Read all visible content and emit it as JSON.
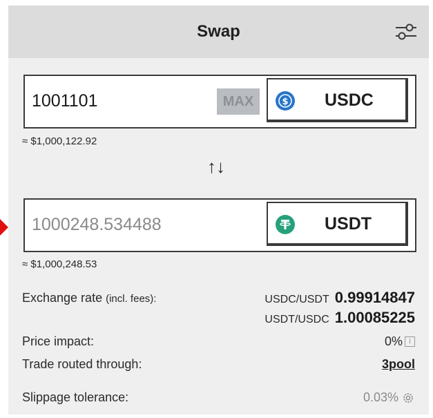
{
  "header": {
    "title": "Swap"
  },
  "from": {
    "amount": "1001101",
    "max_label": "MAX",
    "token": "USDC",
    "usd_estimate": "≈ $1,000,122.92"
  },
  "to": {
    "amount": "1000248.534488",
    "token": "USDT",
    "usd_estimate": "≈ $1,000,248.53"
  },
  "swap_icon": "↑↓",
  "details": {
    "exchange_rate_label": "Exchange rate",
    "exchange_rate_sublabel": "(incl. fees):",
    "rates": [
      {
        "pair": "USDC/USDT",
        "value": "0.99914847"
      },
      {
        "pair": "USDT/USDC",
        "value": "1.00085225"
      }
    ],
    "price_impact_label": "Price impact:",
    "price_impact_value": "0%",
    "route_label": "Trade routed through:",
    "route_value": "3pool",
    "slippage_label": "Slippage tolerance:",
    "slippage_value": "0.03%"
  },
  "icons": {
    "settings": "sliders-icon",
    "usdc": "usdc-coin-icon",
    "usdt": "usdt-coin-icon",
    "info": "info-icon",
    "gear": "gear-icon"
  },
  "colors": {
    "usdc": "#2775CA",
    "usdt": "#26A17B",
    "marker": "#e11010"
  }
}
